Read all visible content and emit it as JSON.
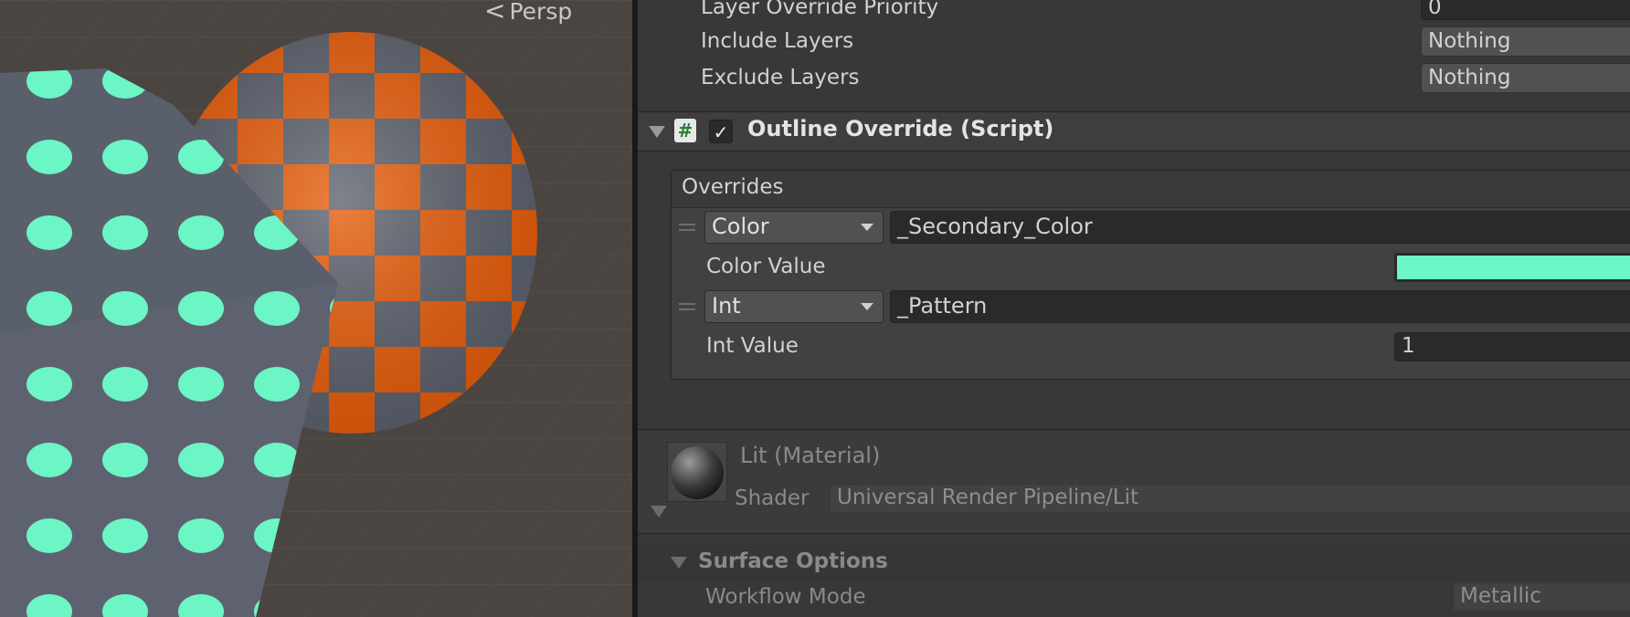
{
  "scene": {
    "view_mode_label": "Persp",
    "colors": {
      "checker_orange": "#e65c0a",
      "checker_gray": "#585d6a",
      "dot_mint": "#6cf5c5",
      "plane_blue_gray": "#5a5f6c",
      "floor": "#4a4541"
    }
  },
  "inspector": {
    "layer_rows": [
      {
        "label": "Layer Override Priority",
        "value": "0"
      },
      {
        "label": "Include Layers",
        "value": "Nothing"
      },
      {
        "label": "Exclude Layers",
        "value": "Nothing"
      }
    ],
    "component": {
      "icon": "script-hash-icon",
      "enabled_mark": "✓",
      "title": "Outline Override (Script)",
      "script_glyph": "#"
    },
    "overrides": {
      "header": "Overrides",
      "items": [
        {
          "type": "Color",
          "property": "_Secondary_Color",
          "value_label": "Color Value",
          "color": "#6cf5c5"
        },
        {
          "type": "Int",
          "property": "_Pattern",
          "value_label": "Int Value",
          "value": "1"
        }
      ]
    },
    "material": {
      "title": "Lit (Material)",
      "shader_label": "Shader",
      "shader_value": "Universal Render Pipeline/Lit"
    },
    "surface_options": {
      "title": "Surface Options",
      "workflow_label": "Workflow Mode",
      "workflow_value": "Metallic"
    }
  }
}
